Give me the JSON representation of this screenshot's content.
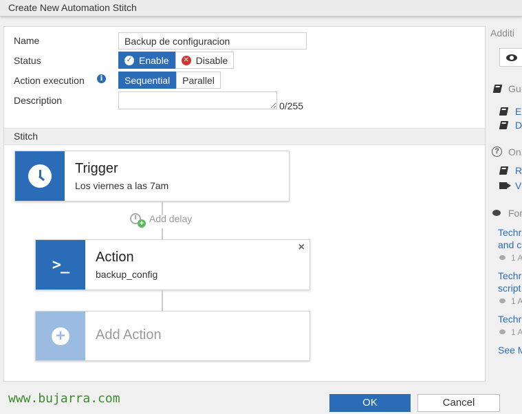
{
  "window": {
    "title": "Create New Automation Stitch"
  },
  "form": {
    "name_label": "Name",
    "name_value": "Backup de configuracion",
    "status_label": "Status",
    "status_options": {
      "enable": "Enable",
      "disable": "Disable"
    },
    "status_selected": "Enable",
    "execution_label": "Action execution",
    "execution_options": {
      "sequential": "Sequential",
      "parallel": "Parallel"
    },
    "execution_selected": "Sequential",
    "description_label": "Description",
    "description_value": "",
    "description_counter": "0/255"
  },
  "stitch": {
    "section_label": "Stitch",
    "trigger": {
      "title": "Trigger",
      "subtitle": "Los viernes a las 7am",
      "icon": "clock-icon"
    },
    "add_delay": "Add delay",
    "action": {
      "title": "Action",
      "subtitle": "backup_config",
      "icon": "terminal-icon",
      "close": "×"
    },
    "add_action": {
      "label": "Add Action",
      "icon": "plus-circle-icon"
    }
  },
  "footer": {
    "watermark": "www.bujarra.com",
    "ok_label": "OK",
    "cancel_label": "Cancel"
  },
  "side_rail": {
    "heading": "Additi",
    "guides_label": "Gu",
    "guide_links": [
      "E",
      "D"
    ],
    "online_label": "On",
    "online_links": [
      "R",
      "V"
    ],
    "forum_label": "For",
    "forum_posts": [
      {
        "line1": "Techr",
        "line2": "and c",
        "meta": "1 A"
      },
      {
        "line1": "Techr",
        "line2": "script",
        "meta": "1 A"
      },
      {
        "line1": "Techr",
        "line2": "",
        "meta": "1 A"
      }
    ],
    "see_more": "See M"
  },
  "colors": {
    "accent": "#2b6cb8",
    "accent_light": "#9bbbe0",
    "disable_icon": "#d0352f",
    "delay_plus": "#5cb85c",
    "watermark": "#3a8a2a"
  }
}
